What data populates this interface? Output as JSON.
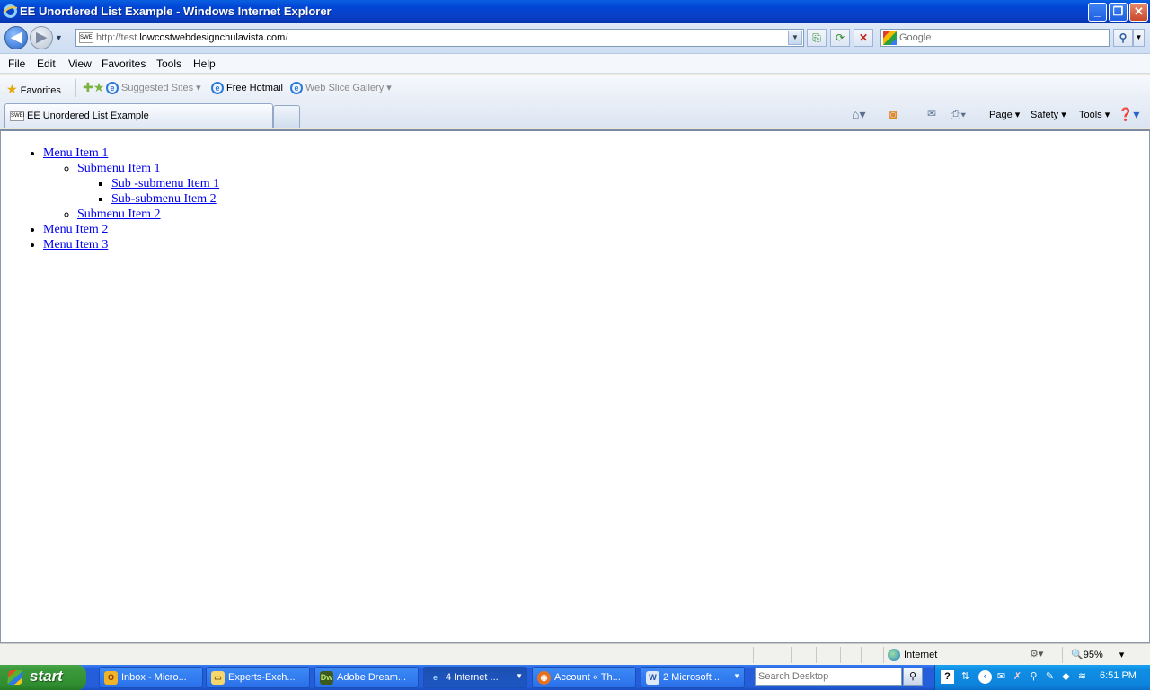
{
  "window": {
    "title": "EE Unordered List Example - Windows Internet Explorer",
    "minimize": "_",
    "restore": "❐",
    "close": "✕"
  },
  "navbar": {
    "url_prefix": "http://test.",
    "url_domain": "lowcostwebdesignchulavista.com",
    "url_suffix": "/",
    "favicon_text": "SWEI",
    "search_placeholder": "Google"
  },
  "menu": {
    "items": [
      "File",
      "Edit",
      "View",
      "Favorites",
      "Tools",
      "Help"
    ]
  },
  "favorites_bar": {
    "favorites_label": "Favorites",
    "suggested_sites": "Suggested Sites",
    "free_hotmail": "Free Hotmail",
    "web_slice_gallery": "Web Slice Gallery"
  },
  "tabs": {
    "active_title": "EE Unordered List Example",
    "commands": {
      "page": "Page",
      "safety": "Safety",
      "tools": "Tools"
    }
  },
  "content": {
    "menu_item_1": "Menu Item 1",
    "submenu_item_1": "Submenu Item 1",
    "sub_submenu_item_1": "Sub -submenu Item 1",
    "sub_submenu_item_2": "Sub-submenu Item 2",
    "submenu_item_2": "Submenu Item 2",
    "menu_item_2": "Menu Item 2",
    "menu_item_3": "Menu Item 3"
  },
  "statusbar": {
    "zone": "Internet",
    "zoom": "95%"
  },
  "taskbar": {
    "start": "start",
    "tasks": [
      {
        "label": "Inbox - Micro..."
      },
      {
        "label": "Experts-Exch..."
      },
      {
        "label": "Adobe Dream..."
      },
      {
        "label": "4 Internet ..."
      },
      {
        "label": "Account « Th..."
      },
      {
        "label": "2 Microsoft ..."
      }
    ],
    "search_placeholder": "Search Desktop",
    "clock": "6:51 PM"
  },
  "colors": {
    "link": "#0000ee",
    "titlebar": "#0046d5",
    "taskbar": "#245edb",
    "start_button": "#3c9a3c"
  }
}
